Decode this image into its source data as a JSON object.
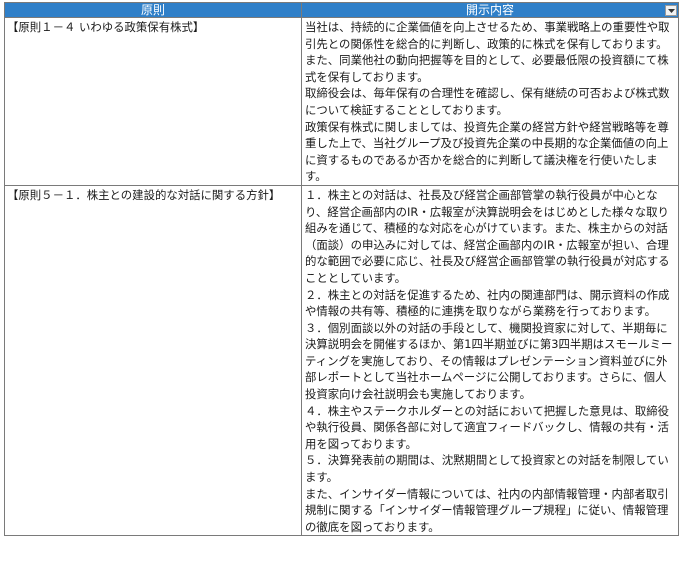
{
  "header": {
    "col1": "原則",
    "col2": "開示内容",
    "filter_icon": "dropdown-arrow-icon"
  },
  "rows": [
    {
      "principle": "【原則１－４ いわゆる政策保有株式】",
      "paragraphs": [
        "当社は、持続的に企業価値を向上させるため、事業戦略上の重要性や取引先との関係性を総合的に判断し、政策的に株式を保有しております。また、同業他社の動向把握等を目的として、必要最低限の投資額にて株式を保有しております。",
        "取締役会は、毎年保有の合理性を確認し、保有継続の可否および株式数について検証することとしております。",
        "政策保有株式に関しましては、投資先企業の経営方針や経営戦略等を尊重した上で、当社グループ及び投資先企業の中長期的な企業価値の向上に資するものであるか否かを総合的に判断して議決権を行使いたします。"
      ]
    },
    {
      "principle": "【原則５－１．株主との建設的な対話に関する方針】",
      "paragraphs": [
        "１．株主との対話は、社長及び経営企画部管掌の執行役員が中心となり、経営企画部内のIR・広報室が決算説明会をはじめとした様々な取り組みを通じて、積極的な対応を心がけています。また、株主からの対話（面談）の申込みに対しては、経営企画部内のIR・広報室が担い、合理的な範囲で必要に応じ、社長及び経営企画部管掌の執行役員が対応することとしています。",
        "２．株主との対話を促進するため、社内の関連部門は、開示資料の作成や情報の共有等、積極的に連携を取りながら業務を行っております。",
        "３．個別面談以外の対話の手段として、機関投資家に対して、半期毎に決算説明会を開催するほか、第1四半期並びに第3四半期はスモールミーティングを実施しており、その情報はプレゼンテーション資料並びに外部レポートとして当社ホームページに公開しております。さらに、個人投資家向け会社説明会も実施しております。",
        "４．株主やステークホルダーとの対話において把握した意見は、取締役や執行役員、関係各部に対して適宜フィードバックし、情報の共有・活用を図っております。",
        "５．決算発表前の期間は、沈黙期間として投資家との対話を制限しています。",
        "また、インサイダー情報については、社内の内部情報管理・内部者取引規制に関する「インサイダー情報管理グループ規程」に従い、情報管理の徹底を図っております。"
      ]
    }
  ]
}
